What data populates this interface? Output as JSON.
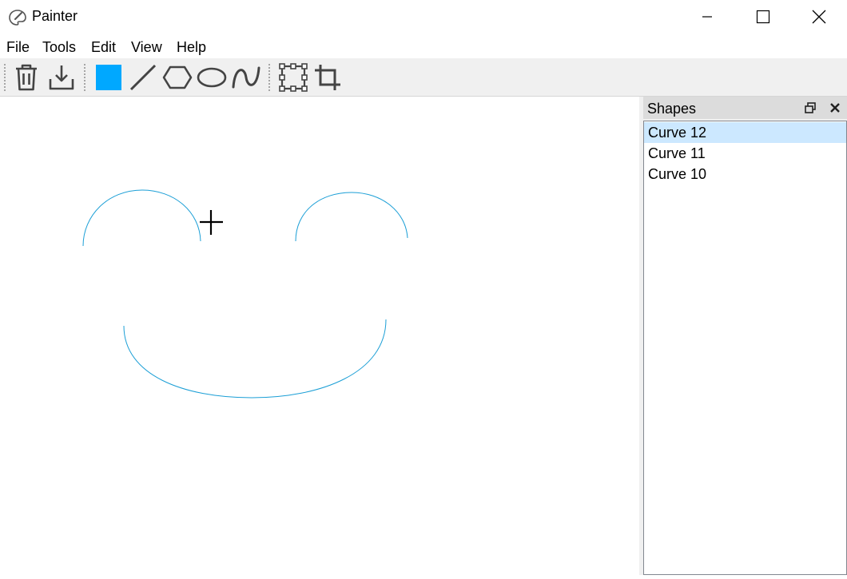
{
  "window": {
    "title": "Painter",
    "icon": "palette-icon",
    "controls": [
      "minimize-icon",
      "maximize-icon",
      "close-icon"
    ]
  },
  "menu": {
    "items": [
      "File",
      "Tools",
      "Edit",
      "View",
      "Help"
    ]
  },
  "toolbar": {
    "tools": [
      "trash-icon",
      "save-icon",
      "fill-color-swatch",
      "line-icon",
      "polygon-icon",
      "ellipse-icon",
      "curve-icon",
      "select-icon",
      "crop-icon"
    ],
    "fill_color": "#00a8ff"
  },
  "canvas": {
    "stroke_color": "#1c9fd6",
    "cursor": "crosshair-cursor"
  },
  "shapes_panel": {
    "title": "Shapes",
    "items": [
      "Curve 12",
      "Curve 11",
      "Curve 10"
    ],
    "selected_index": 0,
    "selected_color": "#cce8ff"
  }
}
